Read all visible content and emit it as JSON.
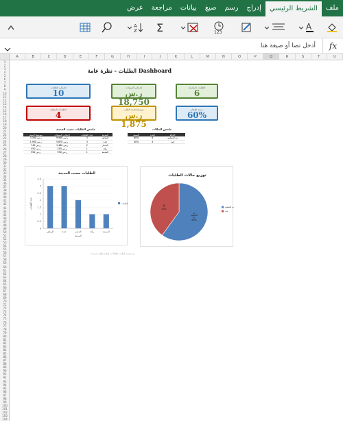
{
  "ribbon": {
    "tabs": [
      "ملف",
      "الشريط الرئيسي",
      "إدراج",
      "رسم",
      "صيغ",
      "بيانات",
      "مراجعة",
      "عرض"
    ]
  },
  "formula_bar": {
    "placeholder": "أدخل نصا أو صيغة هنا",
    "fx": "fx"
  },
  "columns": [
    "A",
    "B",
    "C",
    "D",
    "E",
    "F",
    "G",
    "H",
    "I",
    "J",
    "K",
    "L",
    "M",
    "N",
    "O",
    "P",
    "Q",
    "R",
    "S",
    "T",
    "U"
  ],
  "dashboard": {
    "title": "الطلبات - نظرة عامة Dashboard",
    "kpis": [
      {
        "label": "إجمالي الطلبات",
        "value": "10",
        "color": "#2e75b6",
        "bg": "#ddebf7",
        "text": "#2e75b6"
      },
      {
        "label": "إجمالي المبيعات",
        "value": "ر.س 18,750",
        "color": "#548235",
        "bg": "#e2efda",
        "text": "#548235"
      },
      {
        "label": "الطلبات المكتملة",
        "value": "6",
        "color": "#548235",
        "bg": "#e2efda",
        "text": "#548235"
      },
      {
        "label": "الطلبات المعلقة",
        "value": "4",
        "color": "#c00000",
        "bg": "#fbe4e4",
        "text": "#c00000"
      },
      {
        "label": "متوسط قيمة الطلب",
        "value": "ر.س 1,875",
        "color": "#bf9000",
        "bg": "#fff2cc",
        "text": "#bf9000"
      },
      {
        "label": "نسبة الإنجاز",
        "value": "60%",
        "color": "#2e75b6",
        "bg": "#ddebf7",
        "text": "#2e75b6"
      }
    ]
  },
  "city_table": {
    "title": "ملخص الطلبات حسب المدينة",
    "headers": [
      "المدينة",
      "عدد الطلبات",
      "إجمالي المبيعات",
      "متوسط السعر"
    ],
    "rows": [
      [
        "الرياض",
        "3",
        "ر.س 9,900",
        "ر.س 3,300"
      ],
      [
        "جدة",
        "3",
        "ر.س 5,870",
        "ر.س 1,940"
      ],
      [
        "الدمام",
        "2",
        "ر.س 1,480",
        "ر.س 740"
      ],
      [
        "مكة",
        "1",
        "ر.س 450",
        "ر.س 450"
      ],
      [
        "المدينة",
        "1",
        "ر.س 950",
        "ر.س 950"
      ]
    ]
  },
  "status_table": {
    "title": "ملخص الحالات",
    "headers": [
      "الحالة",
      "العدد",
      "النسبة"
    ],
    "rows": [
      [
        "تم التسليم",
        "6",
        "60%"
      ],
      [
        "قيد",
        "4",
        "40%"
      ]
    ]
  },
  "chart_data": [
    {
      "type": "bar",
      "title": "الطلبات حسب المدينة",
      "categories": [
        "الرياض",
        "جدة",
        "الدمام",
        "مكة",
        "المدينة"
      ],
      "values": [
        3,
        3,
        2,
        1,
        1
      ],
      "xlabel": "المدينة",
      "ylabel": "عدد الطلبات",
      "ylim": [
        0,
        3.5
      ],
      "yticks": [
        "0",
        "0.5",
        "1",
        "1.5",
        "2",
        "2.5",
        "3",
        "3.5"
      ],
      "legend": "عدد الطلبات",
      "color": "#4f81bd"
    },
    {
      "type": "pie",
      "title": "توزيع حالات الطلبات",
      "categories": [
        "تم التسليم",
        "قيد"
      ],
      "values": [
        60,
        40
      ],
      "labels": [
        "تم\nالتسليم\n6\n60%",
        "قيد\n4\n40%"
      ],
      "colors": [
        "#4f81bd",
        "#c0504d"
      ]
    }
  ],
  "footnote": "* يتم تحديث البيانات تلقائياً عند إضافة طلبات جديدة"
}
